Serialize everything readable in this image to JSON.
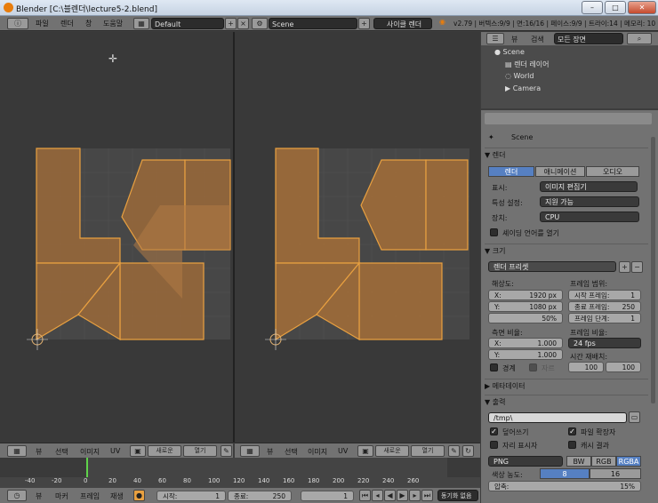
{
  "window": {
    "title": "Blender [C:\\블렌더\\lecture5-2.blend]",
    "min": "–",
    "max": "□",
    "close": "✕"
  },
  "topbar": {
    "menus": [
      "파일",
      "렌더",
      "창",
      "도움말"
    ],
    "layout": "Default",
    "scene": "Scene",
    "engine": "사이클 렌더",
    "stats": "v2.79 | 버텍스:9/9 | 면:16/16 | 페이스:9/9 | 트라이:14 | 메모리: 10"
  },
  "viewport_left": {
    "menus": [
      "뷰",
      "선택",
      "이미지",
      "UV"
    ],
    "new_label": "새로운",
    "open_label": "열기"
  },
  "viewport_right": {
    "menus": [
      "뷰",
      "선택",
      "이미지",
      "UV"
    ],
    "new_label": "새로운",
    "open_label": "열기"
  },
  "timeline": {
    "ticks": [
      "-40",
      "-20",
      "0",
      "20",
      "40",
      "60",
      "80",
      "100",
      "120",
      "140",
      "160",
      "180",
      "200",
      "220",
      "240",
      "260"
    ],
    "menus": [
      "뷰",
      "마커",
      "프레임",
      "재생"
    ],
    "start_label": "시작:",
    "start": "1",
    "end_label": "종료:",
    "end": "250",
    "current": "1",
    "sync": "동기화 없음"
  },
  "outliner": {
    "menus": [
      "뷰",
      "검색"
    ],
    "filter": "모든 장면",
    "items": [
      "Scene",
      "렌더 레이어",
      "World",
      "Camera"
    ]
  },
  "props": {
    "context": "Scene",
    "render": {
      "header": "렌더",
      "tabs": [
        "렌더",
        "애니메이션",
        "오디오"
      ],
      "display_label": "표시:",
      "display": "이미지 편집기",
      "feature_label": "특성 설정:",
      "feature": "지원 가능",
      "device_label": "장치:",
      "device": "CPU",
      "osl": "셰이딩 언어를 열기"
    },
    "dims": {
      "header": "크기",
      "preset": "렌더 프리셋",
      "res_label": "해상도:",
      "x_key": "X:",
      "x": "1920 px",
      "y_key": "Y:",
      "y": "1080 px",
      "pct": "50%",
      "range_label": "프레임 범위:",
      "start_key": "시작 프레임:",
      "start": "1",
      "end_key": "종료 프레임:",
      "end": "250",
      "step_key": "프레임 단계:",
      "step": "1",
      "aspect_label": "측면 비율:",
      "ax_key": "X:",
      "ax": "1.000",
      "ay_key": "Y:",
      "ay": "1.000",
      "rate_label": "프레임 비율:",
      "rate": "24 fps",
      "remap_label": "시간 재배치:",
      "remap_old": "100",
      "remap_new": "100",
      "border": "경계",
      "crop": "자르"
    },
    "metadata": {
      "header": "메타데이터"
    },
    "output": {
      "header": "출력",
      "path": "/tmp\\",
      "overwrite": "덮어쓰기",
      "ext": "파일 확장자",
      "placeholders": "자리 표시자",
      "cache": "캐시 결과",
      "format": "PNG",
      "bw": "BW",
      "rgb": "RGB",
      "rgba": "RGBA",
      "depth_label": "색상 농도:",
      "depth8": "8",
      "depth16": "16",
      "compress_label": "압축:",
      "compress": "15%"
    }
  },
  "colors": {
    "accent": "#5680c2",
    "uv_face": "#9b6a3a",
    "uv_edge": "#e8a040",
    "frame_cursor": "#5fd34b"
  }
}
